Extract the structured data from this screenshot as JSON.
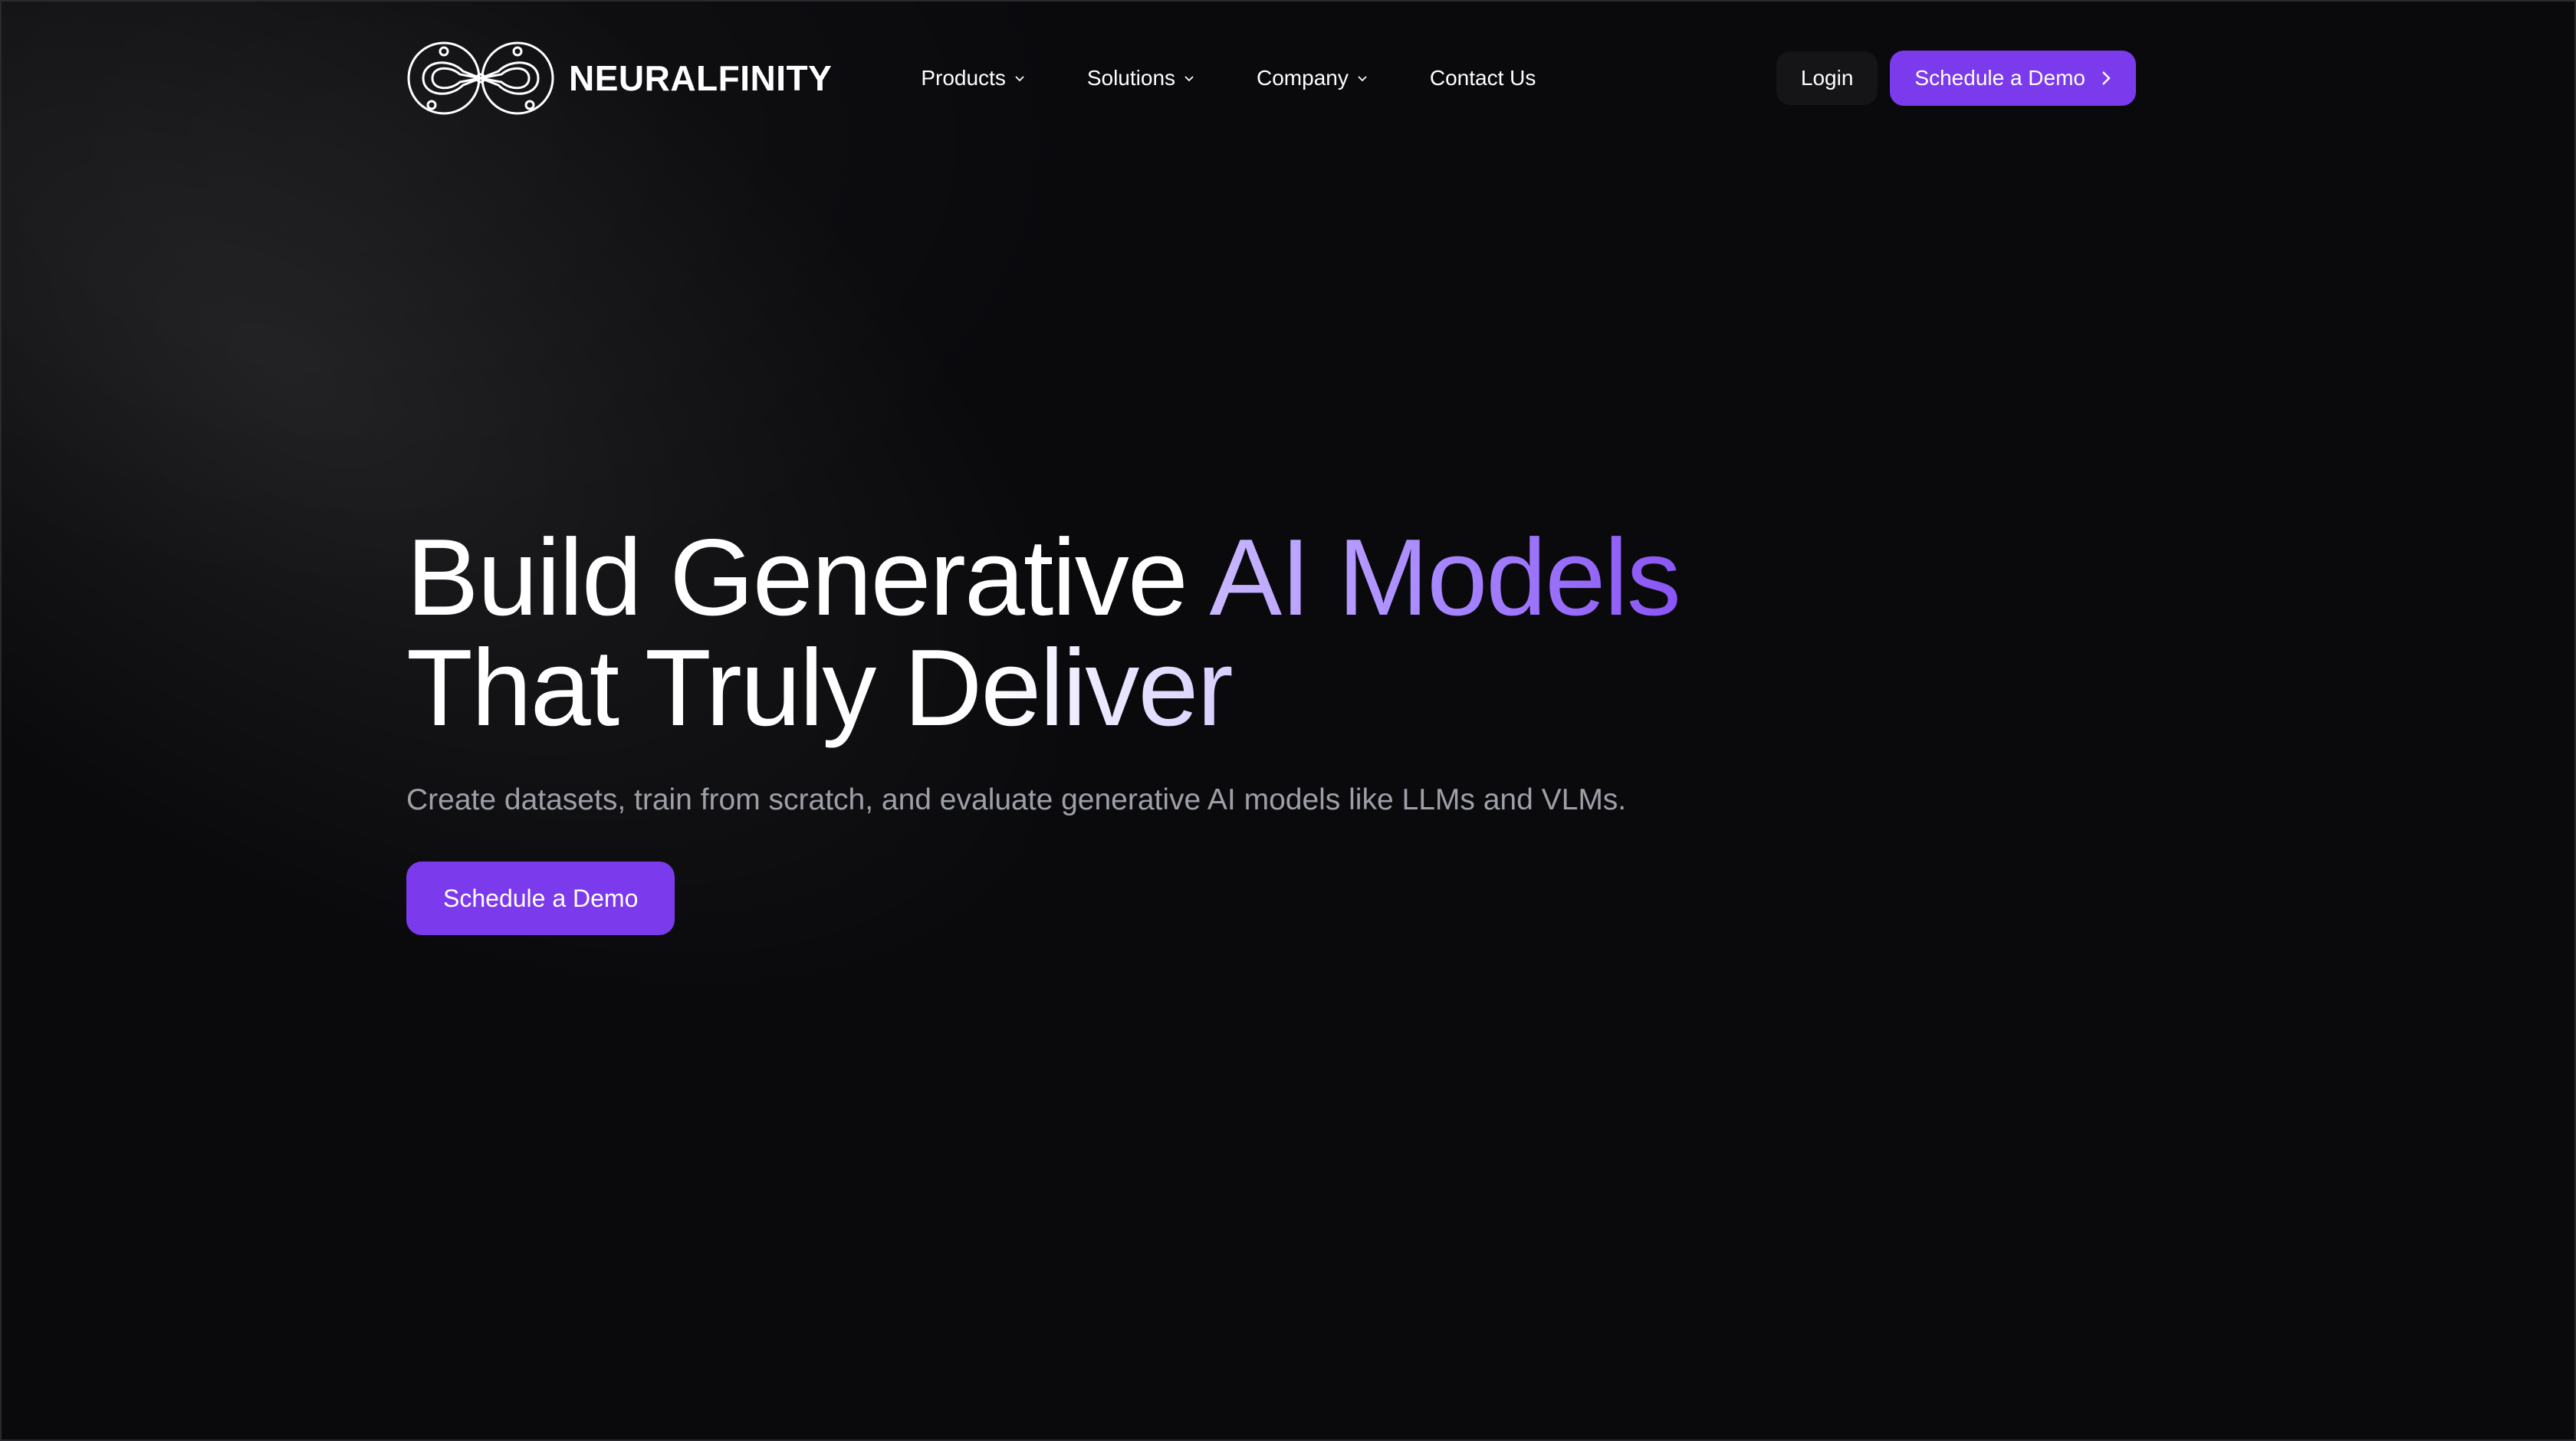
{
  "brand": {
    "name": "NEURALFINITY",
    "logo_icon": "infinity-neural-logo"
  },
  "nav": {
    "items": [
      {
        "label": "Products",
        "icon": "chevron-down-icon"
      },
      {
        "label": "Solutions",
        "icon": "chevron-down-icon"
      },
      {
        "label": "Company",
        "icon": "chevron-down-icon"
      },
      {
        "label": "Contact Us"
      }
    ],
    "login_label": "Login",
    "demo_label": "Schedule a Demo",
    "demo_icon": "chevron-right-icon"
  },
  "hero": {
    "headline_part1": "Build Generative ",
    "headline_accent": "AI Models",
    "headline_line2": "That Truly Deliver",
    "subtitle": "Create datasets, train from scratch, and evaluate generative AI models like LLMs and VLMs.",
    "cta_label": "Schedule a Demo"
  },
  "colors": {
    "background": "#0a0a0d",
    "accent": "#7c3aed",
    "accent_text_gradient": [
      "#c9b8ff",
      "#8a55f5"
    ],
    "subtitle_text": "#9ea0a8"
  }
}
